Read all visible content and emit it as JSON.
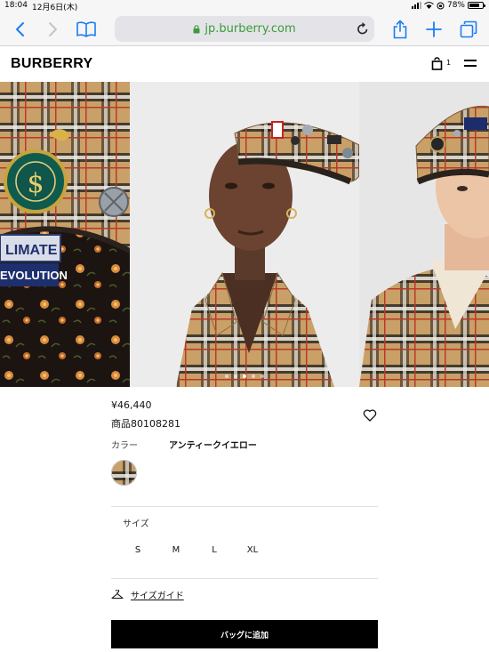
{
  "status_bar": {
    "time": "18:04",
    "date": "12月6日(木)",
    "battery": "78%",
    "battery_level": 0.78
  },
  "browser": {
    "url": "jp.burberry.com",
    "icons": {
      "back": "chevron-left-icon",
      "forward": "chevron-right-icon",
      "bookmarks": "book-icon",
      "secure": "lock-icon",
      "reload": "reload-icon",
      "share": "share-icon",
      "new_tab": "plus-icon",
      "tabs": "tabs-icon"
    }
  },
  "site": {
    "logo": "BURBERRY",
    "bag_count": "1",
    "icons": {
      "bag": "shopping-bag-icon",
      "menu": "hamburger-menu-icon"
    }
  },
  "carousel": {
    "slides": [
      "pin-detail-image",
      "model-woman-image",
      "model-man-image"
    ],
    "pin_texts": [
      "LIMATE",
      "EVOLUTION"
    ],
    "dot_count": 5,
    "active_dot": 2
  },
  "product": {
    "price": "¥46,440",
    "sku": "商品80108281",
    "color_label": "カラー",
    "color_value": "アンティークイエロー",
    "size_label": "サイズ",
    "sizes": [
      "S",
      "M",
      "L",
      "XL"
    ],
    "size_guide": "サイズガイド",
    "add_to_bag": "バッグに追加",
    "icons": {
      "wishlist": "heart-icon",
      "size_guide": "hanger-icon"
    }
  },
  "colors": {
    "accent_green": "#3b9a3b",
    "ios_blue": "#1a7cf5",
    "check_camel": "#c9a067",
    "check_red": "#b83a2a",
    "button_black": "#000000"
  }
}
